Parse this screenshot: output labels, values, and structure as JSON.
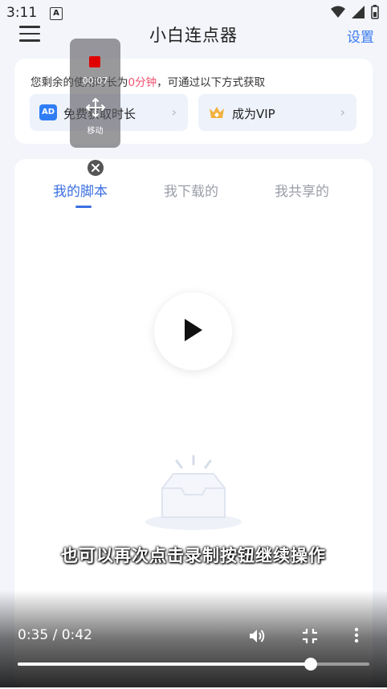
{
  "status_bar": {
    "time": "3:11",
    "badge": "A"
  },
  "header": {
    "title": "小白连点器",
    "settings_label": "设置"
  },
  "usage": {
    "prefix": "您剩余的使用时长为",
    "highlight": "0分钟",
    "suffix": "，可通过以下方式获取",
    "options": [
      {
        "icon": "ad-icon",
        "icon_text": "AD",
        "label": "免费获取时长"
      },
      {
        "icon": "crown-icon",
        "label": "成为VIP"
      }
    ]
  },
  "tabs": [
    {
      "label": "我的脚本",
      "active": true
    },
    {
      "label": "我下载的",
      "active": false
    },
    {
      "label": "我共享的",
      "active": false
    }
  ],
  "float_panel": {
    "rec_time": "00:07",
    "move_label": "移动"
  },
  "video": {
    "subtitle": "也可以再次点击录制按钮继续操作",
    "time_display": "0:35 / 0:42",
    "progress": 0.833
  },
  "colors": {
    "accent": "#3a6fe0",
    "highlight": "#f0506e",
    "rec": "#e00000"
  }
}
